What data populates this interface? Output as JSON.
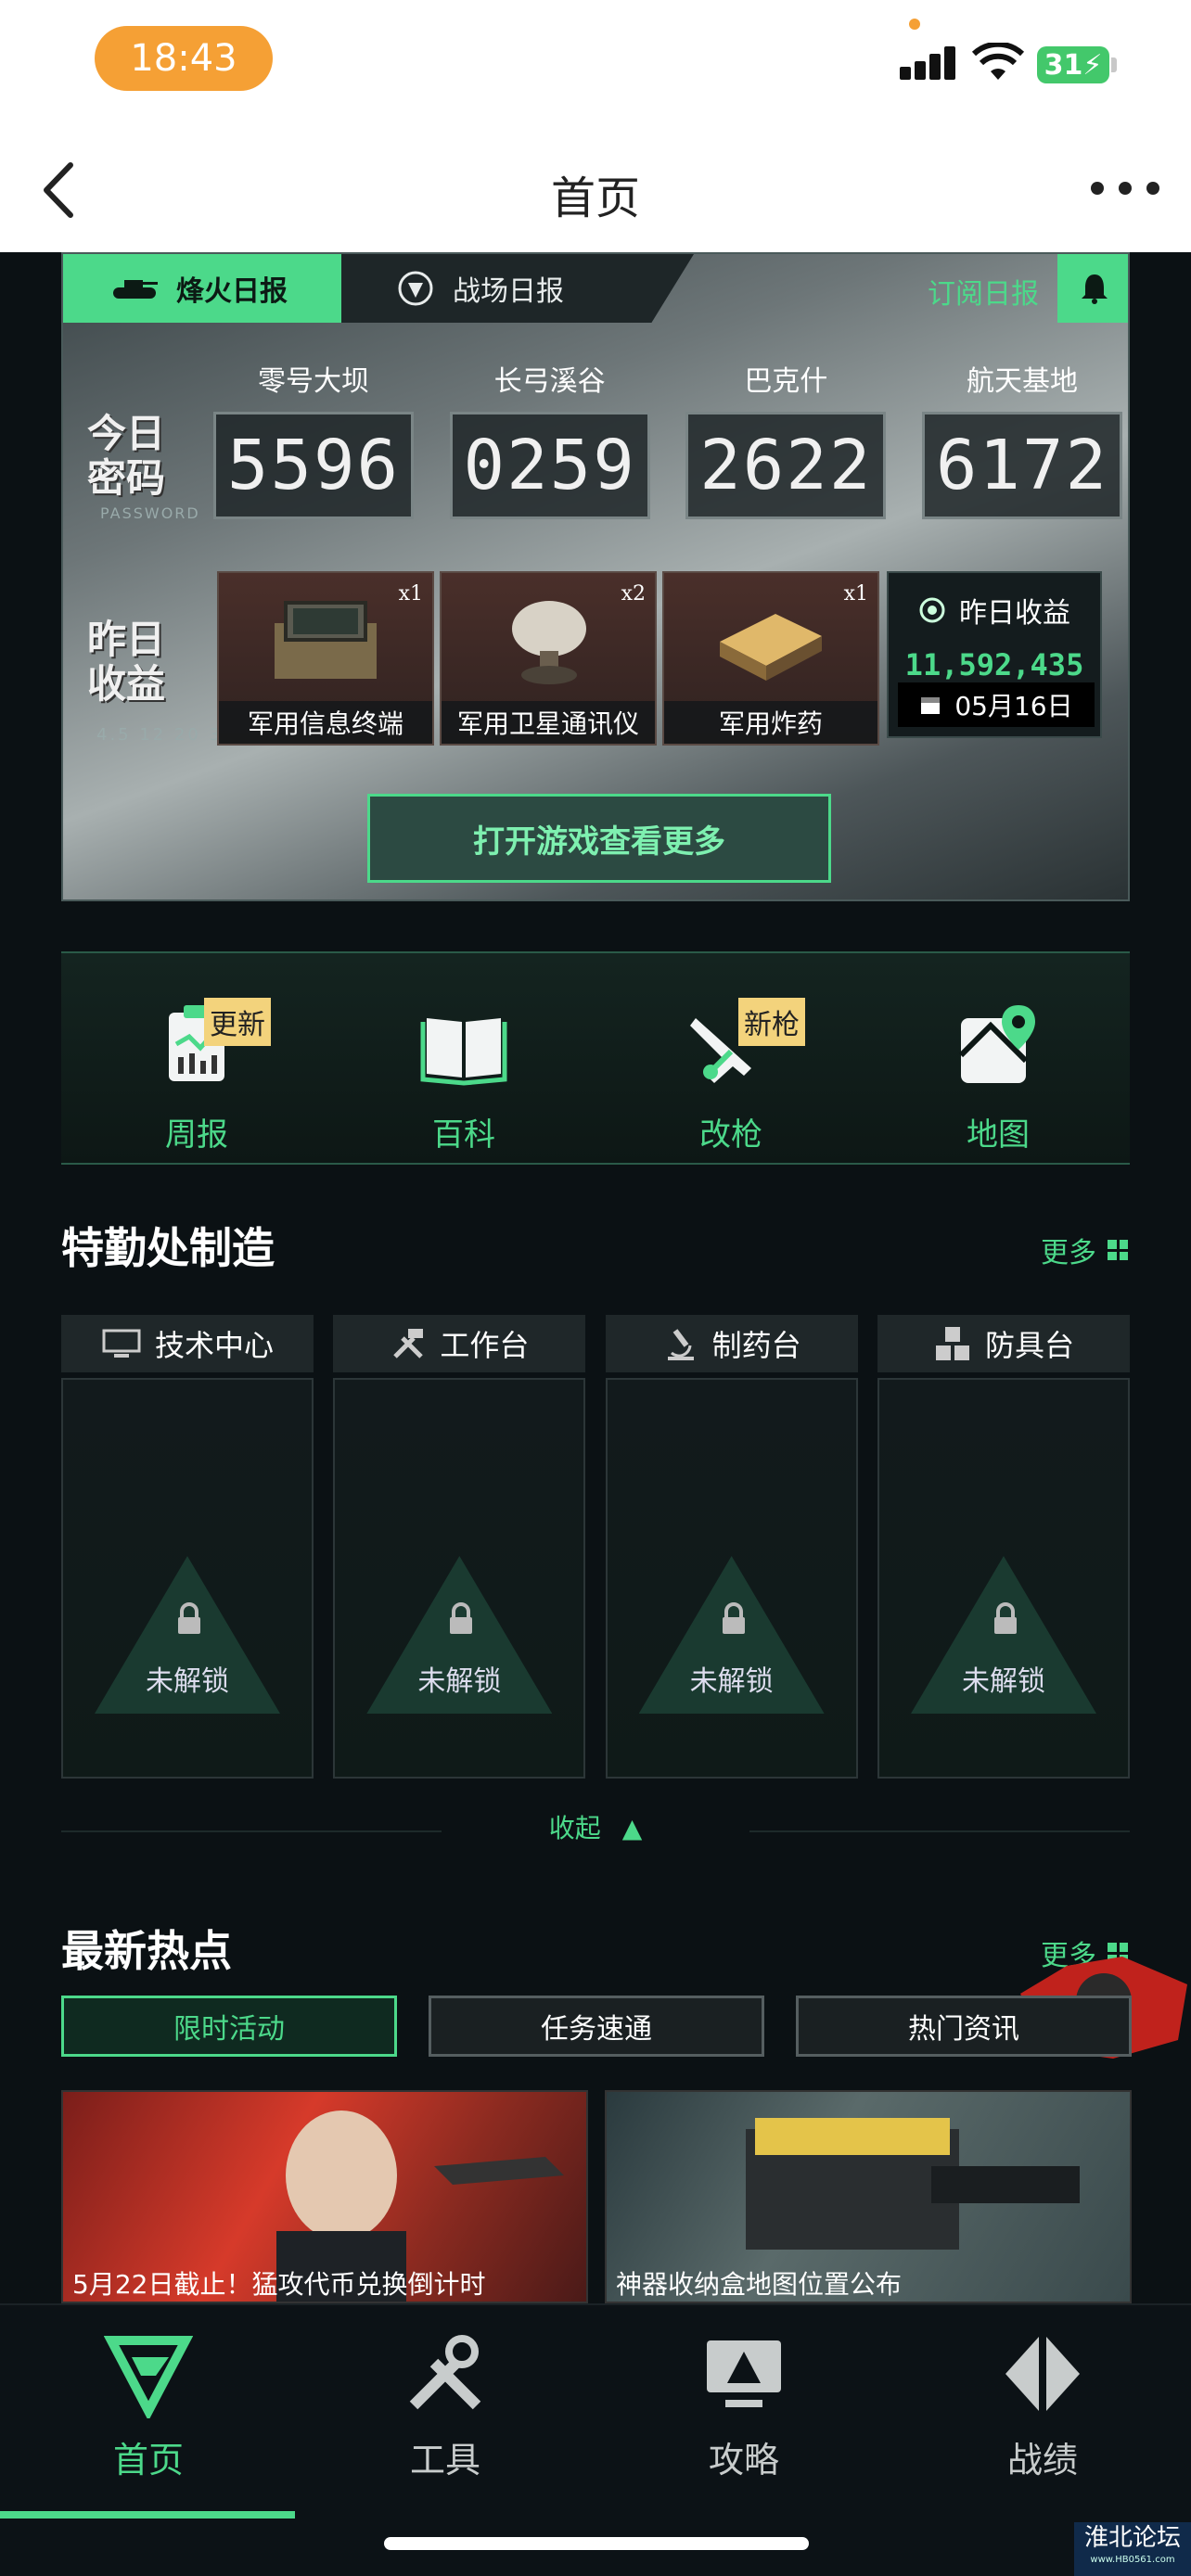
{
  "status_bar": {
    "time": "18:43",
    "battery": "31"
  },
  "header": {
    "title": "首页"
  },
  "report": {
    "tabs": [
      {
        "label": "烽火日报"
      },
      {
        "label": "战场日报"
      }
    ],
    "subscribe": "订阅日报",
    "password_label": "今日密码",
    "password_sub": "PASSWORD",
    "maps": [
      {
        "name": "零号大坝",
        "code": "5596"
      },
      {
        "name": "长弓溪谷",
        "code": "0259"
      },
      {
        "name": "巴克什",
        "code": "2622"
      },
      {
        "name": "航天基地",
        "code": "6172"
      }
    ],
    "yesterday_label": "昨日收益",
    "yesterday_sub": "4.5 12 20 3",
    "items": [
      {
        "name": "军用信息终端",
        "qty": "x1"
      },
      {
        "name": "军用卫星通讯仪",
        "qty": "x2"
      },
      {
        "name": "军用炸药",
        "qty": "x1"
      }
    ],
    "income": {
      "title": "昨日收益",
      "value": "11,592,435",
      "date": "05月16日"
    },
    "open_game": "打开游戏查看更多"
  },
  "quick": [
    {
      "label": "周报",
      "badge": "更新"
    },
    {
      "label": "百科",
      "badge": ""
    },
    {
      "label": "改枪",
      "badge": "新枪"
    },
    {
      "label": "地图",
      "badge": ""
    }
  ],
  "crafting": {
    "title": "特勤处制造",
    "more": "更多",
    "stations": [
      {
        "name": "技术中心",
        "status": "未解锁"
      },
      {
        "name": "工作台",
        "status": "未解锁"
      },
      {
        "name": "制药台",
        "status": "未解锁"
      },
      {
        "name": "防具台",
        "status": "未解锁"
      }
    ],
    "collapse": "收起"
  },
  "hot": {
    "title": "最新热点",
    "more": "更多",
    "tabs": [
      {
        "label": "限时活动"
      },
      {
        "label": "任务速通"
      },
      {
        "label": "热门资讯"
      }
    ],
    "cards": [
      {
        "caption": "5月22日截止！猛攻代币兑换倒计时"
      },
      {
        "caption": "神器收纳盒地图位置公布"
      }
    ]
  },
  "bottom_nav": [
    {
      "label": "首页"
    },
    {
      "label": "工具"
    },
    {
      "label": "攻略"
    },
    {
      "label": "战绩"
    }
  ],
  "watermark": {
    "title": "淮北论坛",
    "url": "www.HB0561.com"
  },
  "colors": {
    "accent": "#4cd98a",
    "background": "#0b1114",
    "badge": "#f3d37c",
    "status_time": "#f5a035"
  }
}
